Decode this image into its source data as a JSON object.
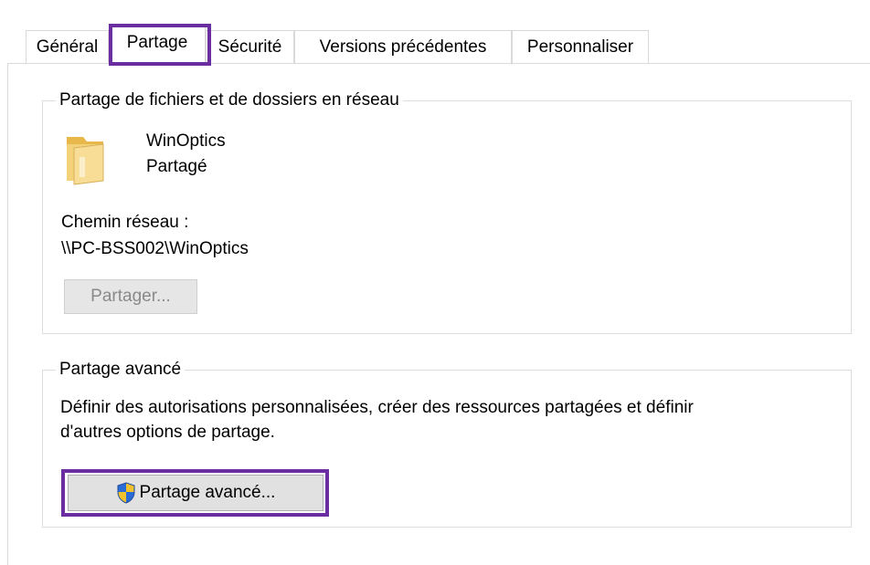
{
  "tabs": [
    {
      "label": "Général",
      "active": false
    },
    {
      "label": "Partage",
      "active": true
    },
    {
      "label": "Sécurité",
      "active": false
    },
    {
      "label": "Versions précédentes",
      "active": false
    },
    {
      "label": "Personnaliser",
      "active": false
    }
  ],
  "network_sharing": {
    "legend": "Partage de fichiers et de dossiers en réseau",
    "folder_name": "WinOptics",
    "folder_status": "Partagé",
    "path_label": "Chemin réseau :",
    "path_value": "\\\\PC-BSS002\\WinOptics",
    "share_button": "Partager...",
    "folder_icon": "folder-icon"
  },
  "advanced_sharing": {
    "legend": "Partage avancé",
    "description_line1": "Définir des autorisations personnalisées, créer des ressources partagées et définir",
    "description_line2": "d'autres options de partage.",
    "button_label": "Partage avancé...",
    "button_icon": "uac-shield-icon"
  },
  "colors": {
    "highlight": "#6a2ea0",
    "shield_blue": "#2b6bd6",
    "shield_yellow": "#f2c12e",
    "folder_yellow": "#f3d27a"
  }
}
